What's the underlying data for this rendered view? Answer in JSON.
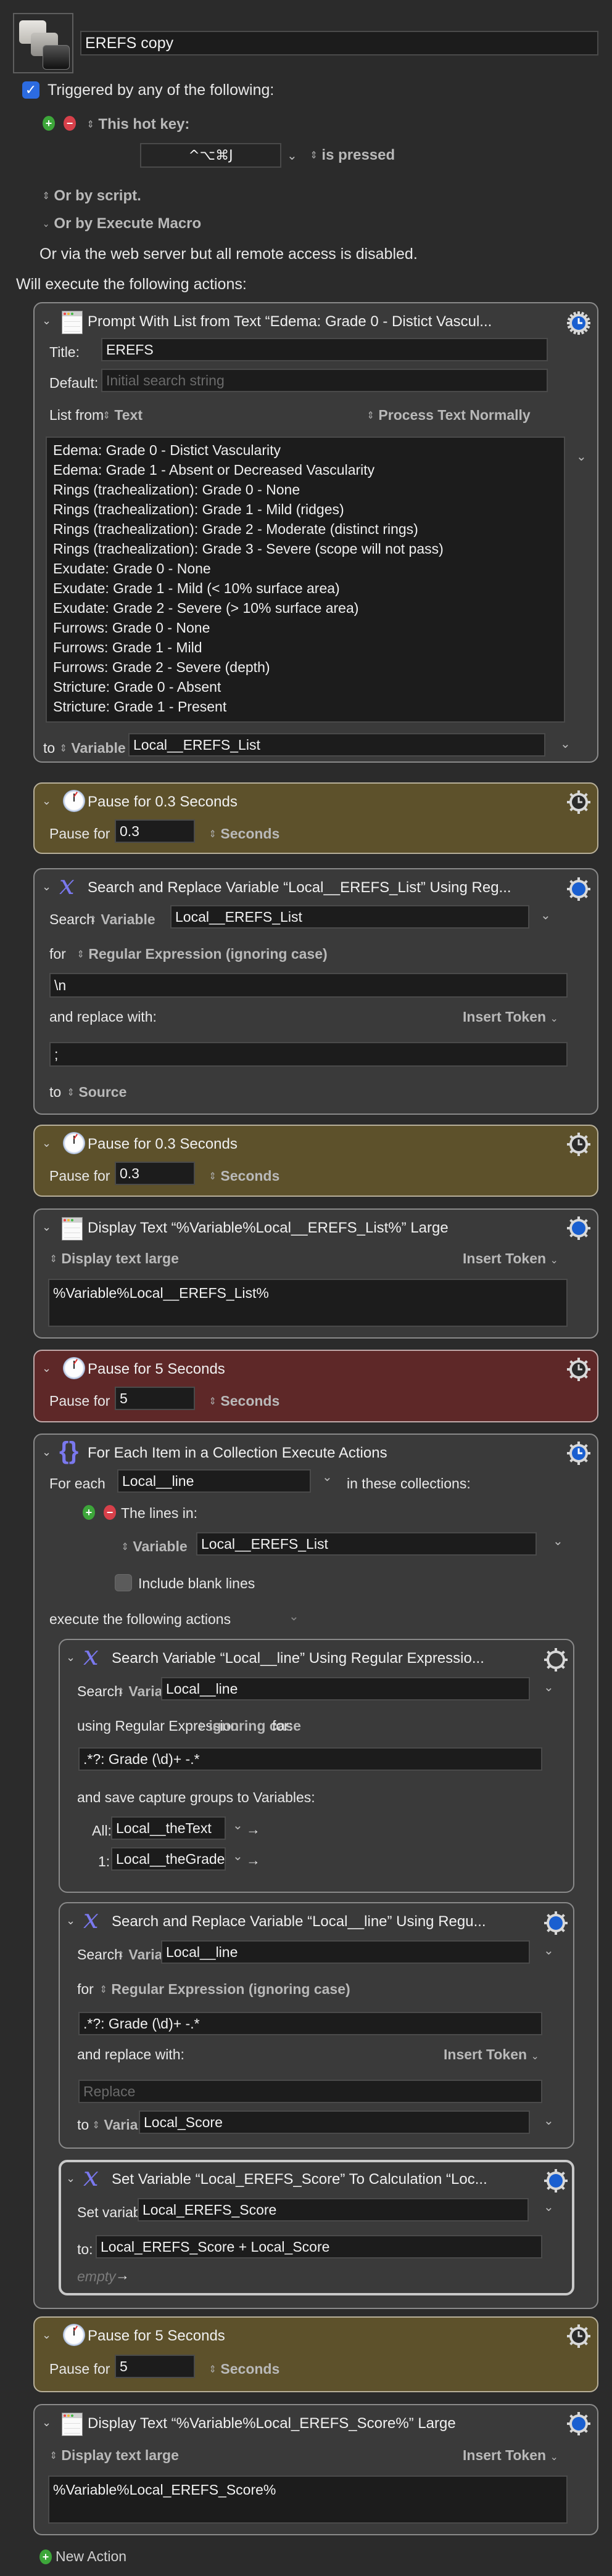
{
  "macro": {
    "name": "EREFS copy",
    "icon": "keycaps-icon"
  },
  "triggers": {
    "enabled": true,
    "heading": "Triggered by any of the following:",
    "hotkey_label": "This hot key:",
    "hotkey_value": "^⌥⌘J",
    "hotkey_condition": "is pressed",
    "or_by_script": "Or by script.",
    "or_by_execute_macro": "Or by Execute Macro",
    "web_server_note": "Or via the web server but all remote access is disabled."
  },
  "will_execute_label": "Will execute the following actions:",
  "actions": {
    "prompt": {
      "title": "Prompt With List from Text “Edema: Grade 0 - Distict Vascul...",
      "title_label": "Title:",
      "title_value": "EREFS",
      "default_label": "Default:",
      "default_placeholder": "Initial search string",
      "list_from_label": "List from",
      "list_from_value": "Text",
      "process_mode": "Process Text Normally",
      "list_items": [
        "Edema: Grade 0 - Distict Vascularity",
        "Edema: Grade 1 - Absent or Decreased Vascularity",
        "Rings (trachealization): Grade 0 - None",
        "Rings (trachealization): Grade 1 - Mild (ridges)",
        "Rings (trachealization): Grade 2 - Moderate (distinct rings)",
        "Rings (trachealization): Grade 3 - Severe (scope will not pass)",
        "Exudate: Grade 0 - None",
        "Exudate: Grade 1 - Mild (< 10% surface area)",
        "Exudate: Grade 2 - Severe (> 10% surface area)",
        "Furrows: Grade 0 - None",
        "Furrows: Grade 1 - Mild",
        "Furrows: Grade 2 - Severe (depth)",
        "Stricture: Grade 0 - Absent",
        "Stricture: Grade 1 - Present"
      ],
      "to_label": "to",
      "to_type": "Variable",
      "to_value": "Local__EREFS_List"
    },
    "pause1": {
      "title": "Pause for 0.3 Seconds",
      "label": "Pause for",
      "value": "0.3",
      "unit": "Seconds"
    },
    "search_replace1": {
      "title": "Search and Replace Variable “Local__EREFS_List” Using Reg...",
      "search_label": "Search",
      "search_type": "Variable",
      "search_value": "Local__EREFS_List",
      "for_label": "for",
      "for_mode": "Regular Expression (ignoring case)",
      "pattern": "\\n",
      "replace_label": "and replace with:",
      "insert_token": "Insert Token",
      "replacement": ";",
      "to_label": "to",
      "to_value": "Source"
    },
    "pause2": {
      "title": "Pause for 0.3 Seconds",
      "label": "Pause for",
      "value": "0.3",
      "unit": "Seconds"
    },
    "display1": {
      "title": "Display Text “%Variable%Local__EREFS_List%” Large",
      "mode": "Display text large",
      "insert_token": "Insert Token",
      "text": "%Variable%Local__EREFS_List%"
    },
    "pause3": {
      "title": "Pause for 5 Seconds",
      "label": "Pause for",
      "value": "5",
      "unit": "Seconds"
    },
    "foreach": {
      "title": "For Each Item in a Collection Execute Actions",
      "for_each_label": "For each",
      "variable": "Local__line",
      "in_label": "in these collections:",
      "collection_label": "The lines in:",
      "collection_type": "Variable",
      "collection_value": "Local__EREFS_List",
      "include_blank_label": "Include blank lines",
      "include_blank": false,
      "execute_label": "execute the following actions",
      "inner": {
        "search": {
          "title": "Search Variable “Local__line” Using Regular Expressio...",
          "search_label": "Search",
          "search_type": "Variable",
          "search_value": "Local__line",
          "using_label": "using Regular Expression",
          "case_mode": "ignoring case",
          "for_label": "for:",
          "pattern": ".*?: Grade (\\d)+ -.*",
          "save_label": "and save capture groups to Variables:",
          "all_label": "All:",
          "all_value": "Local__theText",
          "group1_label": "1:",
          "group1_value": "Local__theGrade"
        },
        "search_replace": {
          "title": "Search and Replace Variable “Local__line” Using Regu...",
          "search_label": "Search",
          "search_type": "Variable",
          "search_value": "Local__line",
          "for_label": "for",
          "for_mode": "Regular Expression (ignoring case)",
          "pattern": ".*?: Grade (\\d)+ -.*",
          "replace_label": "and replace with:",
          "insert_token": "Insert Token",
          "replace_placeholder": "Replace",
          "to_label": "to",
          "to_type": "Variable",
          "to_value": "Local_Score"
        },
        "set_variable": {
          "title": "Set Variable “Local_EREFS_Score” To Calculation “Loc...",
          "set_label": "Set variable",
          "variable": "Local_EREFS_Score",
          "to_label": "to:",
          "calculation": "Local_EREFS_Score + Local_Score",
          "empty_label": "empty"
        }
      }
    },
    "pause4": {
      "title": "Pause for 5 Seconds",
      "label": "Pause for",
      "value": "5",
      "unit": "Seconds"
    },
    "display2": {
      "title": "Display Text “%Variable%Local_EREFS_Score%” Large",
      "mode": "Display text large",
      "insert_token": "Insert Token",
      "text": "%Variable%Local_EREFS_Score%"
    }
  },
  "new_action_label": "New Action",
  "colors": {
    "background": "#2b2b2b",
    "action_bg": "#3a3a3a",
    "pause_bg": "#5d512b",
    "pause_red_bg": "#5e2828",
    "gear_blue": "#1a5fd0",
    "accent_purple": "#7a78ee",
    "checkbox_blue": "#2c6be0"
  }
}
